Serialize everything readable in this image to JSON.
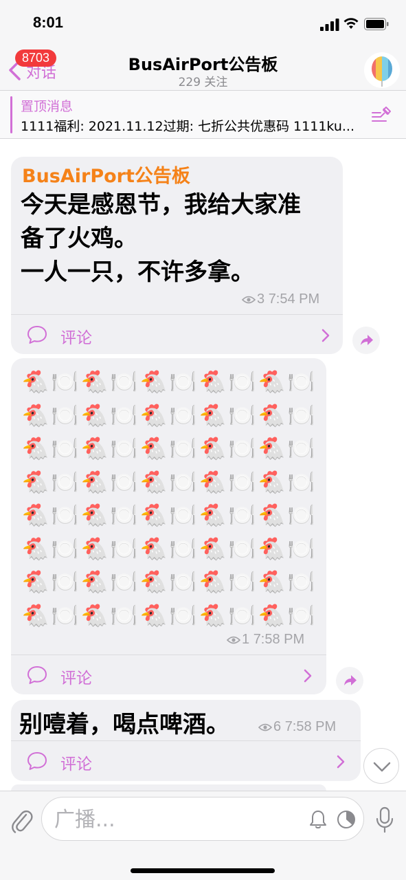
{
  "status_bar": {
    "time": "8:01"
  },
  "nav": {
    "back_badge": "8703",
    "back_label": "对话",
    "title": "BusAirPort公告板",
    "subtitle": "229 关注"
  },
  "pinned": {
    "title": "置顶消息",
    "text": "1111福利: 2021.11.12过期: 七折公共优惠码 1111ku..."
  },
  "messages": [
    {
      "sender": "BusAirPort公告板",
      "lines": [
        "今天是感恩节，我给大家准",
        "备了火鸡。",
        "一人一只，不许多拿。"
      ],
      "views": "3",
      "time": "7:54 PM",
      "comment_label": "评论"
    },
    {
      "emoji_a": "🐔",
      "emoji_b": "🍽️",
      "rows": 8,
      "pairs_per_row": 5,
      "views": "1",
      "time": "7:58 PM",
      "comment_label": "评论"
    },
    {
      "text": "别噎着，喝点啤酒。",
      "views": "6",
      "time": "7:58 PM",
      "comment_label": "评论"
    }
  ],
  "input": {
    "placeholder": "广播..."
  },
  "colors": {
    "accent": "#d16fd6",
    "sender": "#f58219",
    "badge": "#f23a3c",
    "bubble": "#f0f0f3"
  },
  "icons": {
    "back": "chevron-left-icon",
    "pin": "pin-icon",
    "comment": "speech-bubble-icon",
    "share": "share-arrow-icon",
    "scroll": "chevron-down-icon",
    "attach": "paperclip-icon",
    "bell": "bell-icon",
    "timer": "timer-icon",
    "mic": "microphone-icon"
  }
}
